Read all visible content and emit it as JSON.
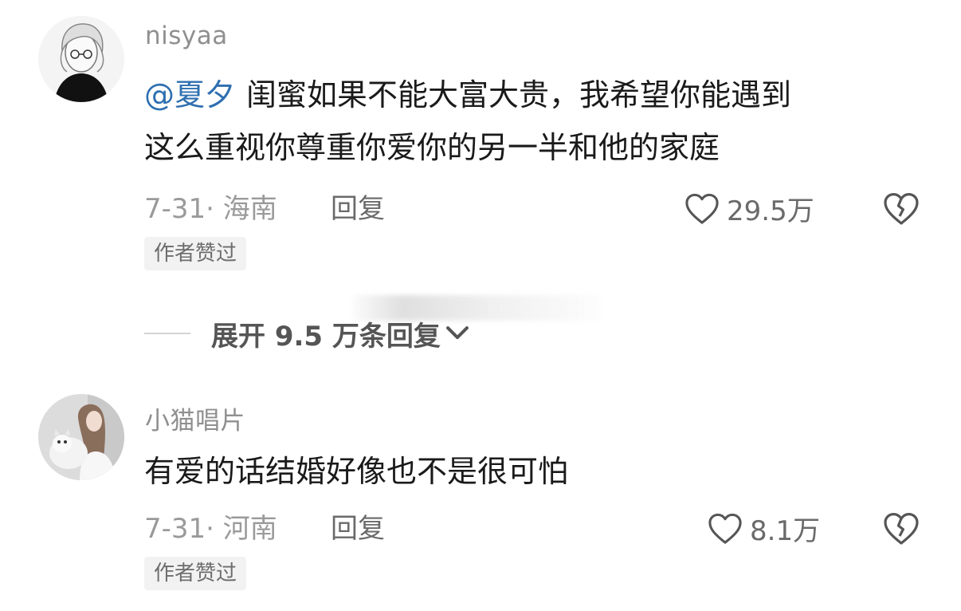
{
  "comments": [
    {
      "username": "nisyaa",
      "mention": "@夏夕",
      "text_line1": "闺蜜如果不能大富大贵，我希望你能遇到",
      "text_line2": "这么重视你尊重你爱你的另一半和他的家庭",
      "date_location": "7-31· 海南",
      "reply_label": "回复",
      "like_count": "29.5万",
      "badge": "作者赞过"
    },
    {
      "username": "小猫唱片",
      "text_line1": "有爱的话结婚好像也不是很可怕",
      "date_location": "7-31· 河南",
      "reply_label": "回复",
      "like_count": "8.1万",
      "badge": "作者赞过"
    }
  ],
  "expand_replies": {
    "label": "展开 9.5 万条回复"
  },
  "icons": {
    "like": "heart-outline-icon",
    "dislike": "broken-heart-icon",
    "expand": "chevron-down-icon"
  },
  "colors": {
    "mention": "#2e6fb0",
    "meta_text": "#9a9a9a",
    "badge_bg": "#f2f2f2"
  }
}
